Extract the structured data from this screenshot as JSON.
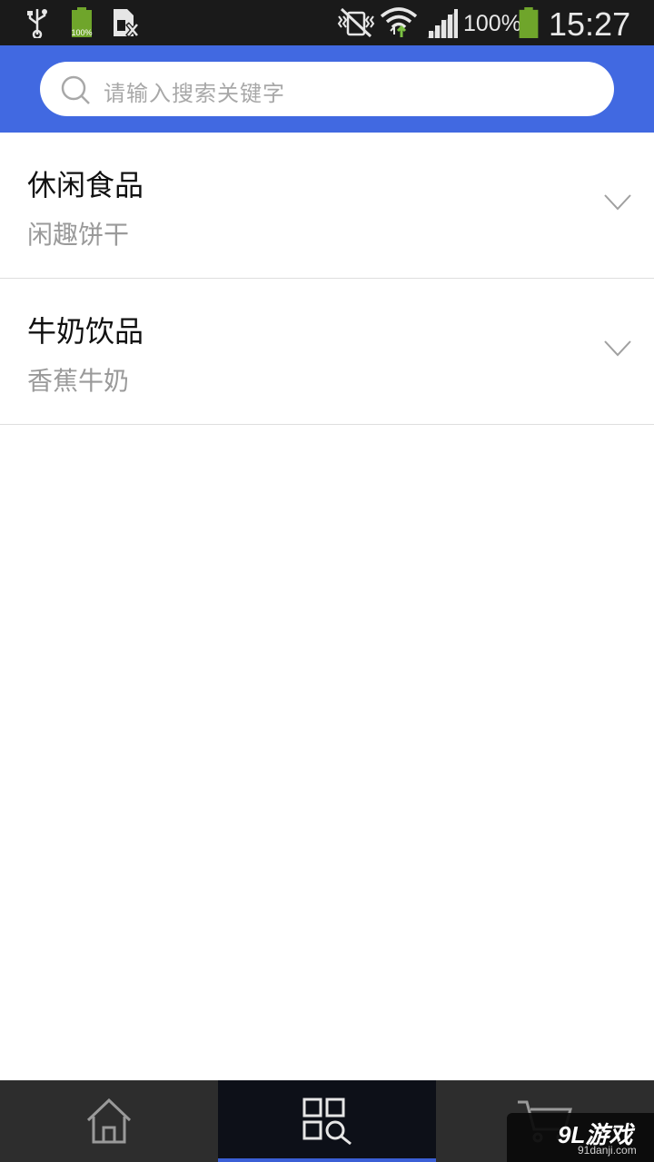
{
  "status_bar": {
    "battery_small_label": "100%",
    "battery_percent": "100%",
    "time": "15:27",
    "icons": [
      "usb-icon",
      "battery-full-small-icon",
      "sim-card-icon",
      "vibrate-mute-icon",
      "wifi-icon",
      "cell-signal-icon",
      "battery-icon"
    ]
  },
  "search": {
    "placeholder": "请输入搜索关键字"
  },
  "categories": [
    {
      "title": "休闲食品",
      "subtitle": "闲趣饼干"
    },
    {
      "title": "牛奶饮品",
      "subtitle": "香蕉牛奶"
    }
  ],
  "bottom_nav": {
    "tabs": [
      {
        "name": "home",
        "icon": "home-icon",
        "active": false
      },
      {
        "name": "category",
        "icon": "category-search-icon",
        "active": true
      },
      {
        "name": "cart",
        "icon": "cart-icon",
        "active": false
      }
    ]
  },
  "watermark": {
    "logo": "9L游戏",
    "url": "91danji.com"
  },
  "colors": {
    "header_blue": "#4169e1",
    "status_bar": "#1a1a1a",
    "nav_bar": "#2b2b2b",
    "nav_active": "#0d1018",
    "battery_green": "#6fa52b"
  }
}
